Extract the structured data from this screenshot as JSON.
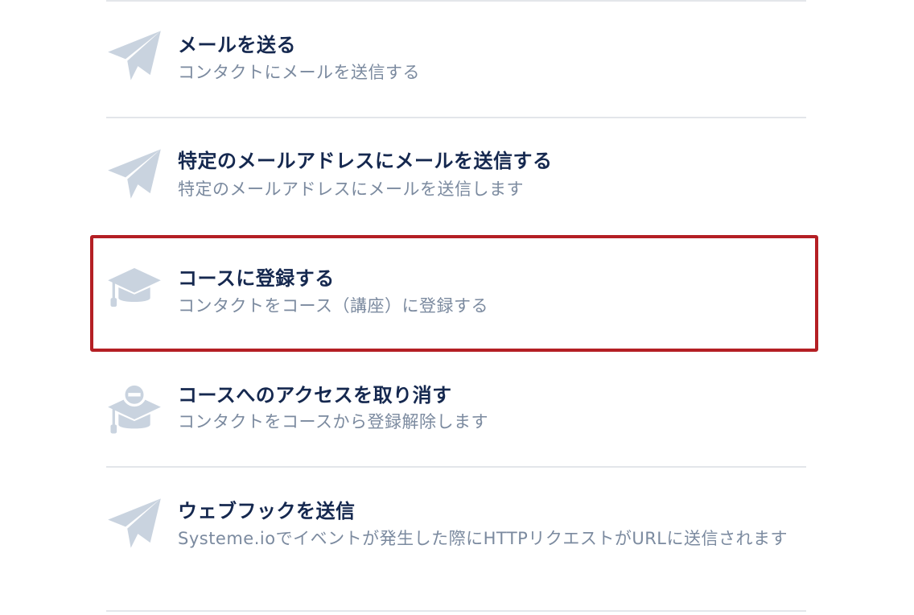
{
  "actions": [
    {
      "title": "メールを送る",
      "description": "コンタクトにメールを送信する",
      "icon": "paper-plane-icon"
    },
    {
      "title": "特定のメールアドレスにメールを送信する",
      "description": "特定のメールアドレスにメールを送信します",
      "icon": "paper-plane-icon"
    },
    {
      "title": "コースに登録する",
      "description": "コンタクトをコース（講座）に登録する",
      "icon": "graduation-cap-icon",
      "selected": true
    },
    {
      "title": "コースへのアクセスを取り消す",
      "description": "コンタクトをコースから登録解除します",
      "icon": "graduation-cap-minus-icon"
    },
    {
      "title": "ウェブフックを送信",
      "description": "Systeme.ioでイベントが発生した際にHTTPリクエストがURLに送信されます",
      "icon": "paper-plane-icon"
    }
  ],
  "colors": {
    "title": "#15284f",
    "description": "#7b8a9f",
    "icon": "#c9d3df",
    "divider": "#e3e6ea",
    "highlight_border": "#b41f24"
  }
}
